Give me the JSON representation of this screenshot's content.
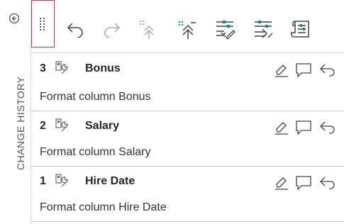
{
  "sidebar": {
    "title": "CHANGE HISTORY",
    "collapse_icon": "collapse-panel-icon"
  },
  "toolbar": {
    "icons": [
      "drag-handle-icon",
      "undo-icon",
      "redo-icon",
      "move-to-top-icon",
      "expand-all-icon",
      "apply-icon",
      "replay-icon",
      "script-icon"
    ]
  },
  "entries": [
    {
      "number": "3",
      "column": "Bonus",
      "description": "Format column Bonus"
    },
    {
      "number": "2",
      "column": "Salary",
      "description": "Format column Salary"
    },
    {
      "number": "1",
      "column": "Hire Date",
      "description": "Format column Hire Date"
    }
  ]
}
